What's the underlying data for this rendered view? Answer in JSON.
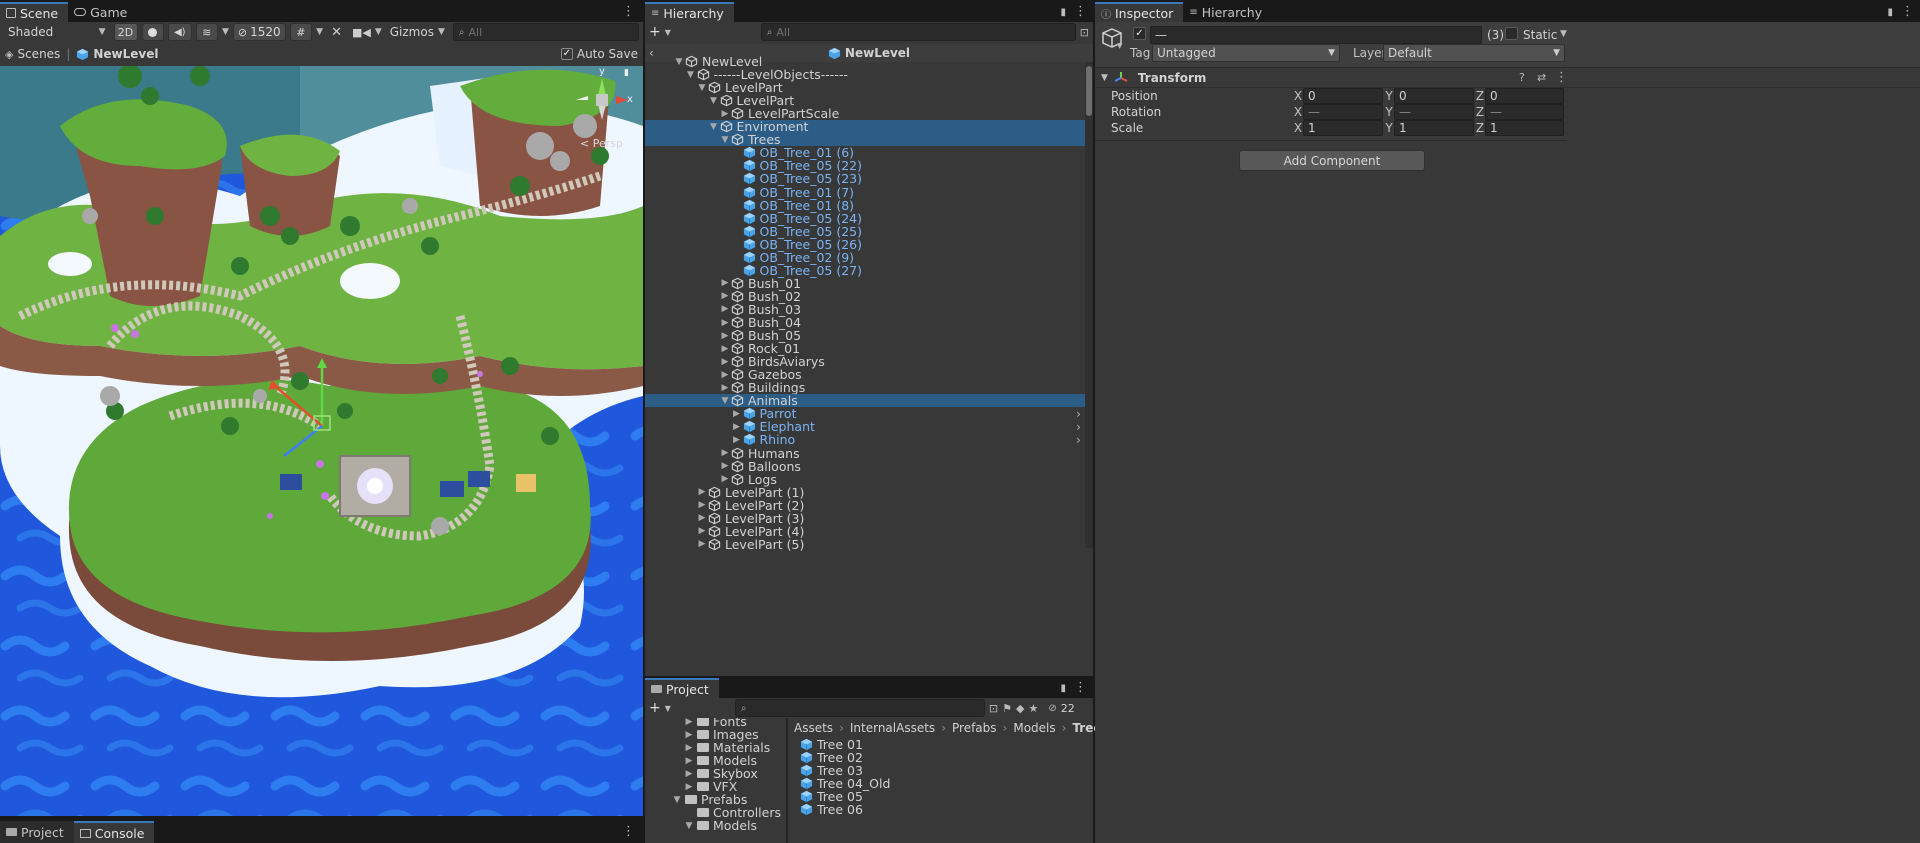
{
  "scene_panel": {
    "tab_scene": "Scene",
    "tab_game": "Game",
    "shading_mode": "Shaded",
    "toggle_2d": "2D",
    "hidden_count": "1520",
    "gizmos": "Gizmos",
    "search_placeholder": "All",
    "breadcrumb_scenes": "Scenes",
    "breadcrumb_level": "NewLevel",
    "auto_save": "Auto Save",
    "persp": "< Persp",
    "axis_y": "y",
    "axis_x": "x"
  },
  "hierarchy": {
    "tab": "Hierarchy",
    "search_placeholder": "All",
    "scene_name": "NewLevel",
    "rows": [
      {
        "label": "NewLevel",
        "depth": 0,
        "arrow": "down",
        "type": "object",
        "selected": false
      },
      {
        "label": "------LevelObjects------",
        "depth": 1,
        "arrow": "down",
        "type": "object",
        "selected": false
      },
      {
        "label": "LevelPart",
        "depth": 2,
        "arrow": "down",
        "type": "object",
        "selected": false
      },
      {
        "label": "LevelPart",
        "depth": 3,
        "arrow": "down",
        "type": "object",
        "selected": false
      },
      {
        "label": "LevelPartScale",
        "depth": 4,
        "arrow": "right",
        "type": "object",
        "selected": false
      },
      {
        "label": "Enviroment",
        "depth": 3,
        "arrow": "down",
        "type": "object",
        "selected": true
      },
      {
        "label": "Trees",
        "depth": 4,
        "arrow": "down",
        "type": "object",
        "selected": true
      },
      {
        "label": "OB_Tree_01 (6)",
        "depth": 5,
        "arrow": "none",
        "type": "prefab",
        "selected": false
      },
      {
        "label": "OB_Tree_05 (22)",
        "depth": 5,
        "arrow": "none",
        "type": "prefab",
        "selected": false
      },
      {
        "label": "OB_Tree_05 (23)",
        "depth": 5,
        "arrow": "none",
        "type": "prefab",
        "selected": false
      },
      {
        "label": "OB_Tree_01 (7)",
        "depth": 5,
        "arrow": "none",
        "type": "prefab",
        "selected": false
      },
      {
        "label": "OB_Tree_01 (8)",
        "depth": 5,
        "arrow": "none",
        "type": "prefab",
        "selected": false
      },
      {
        "label": "OB_Tree_05 (24)",
        "depth": 5,
        "arrow": "none",
        "type": "prefab",
        "selected": false
      },
      {
        "label": "OB_Tree_05 (25)",
        "depth": 5,
        "arrow": "none",
        "type": "prefab",
        "selected": false
      },
      {
        "label": "OB_Tree_05 (26)",
        "depth": 5,
        "arrow": "none",
        "type": "prefab",
        "selected": false
      },
      {
        "label": "OB_Tree_02 (9)",
        "depth": 5,
        "arrow": "none",
        "type": "prefab",
        "selected": false
      },
      {
        "label": "OB_Tree_05 (27)",
        "depth": 5,
        "arrow": "none",
        "type": "prefab",
        "selected": false
      },
      {
        "label": "Bush_01",
        "depth": 4,
        "arrow": "right",
        "type": "object",
        "selected": false
      },
      {
        "label": "Bush_02",
        "depth": 4,
        "arrow": "right",
        "type": "object",
        "selected": false
      },
      {
        "label": "Bush_03",
        "depth": 4,
        "arrow": "right",
        "type": "object",
        "selected": false
      },
      {
        "label": "Bush_04",
        "depth": 4,
        "arrow": "right",
        "type": "object",
        "selected": false
      },
      {
        "label": "Bush_05",
        "depth": 4,
        "arrow": "right",
        "type": "object",
        "selected": false
      },
      {
        "label": "Rock_01",
        "depth": 4,
        "arrow": "right",
        "type": "object",
        "selected": false
      },
      {
        "label": "BirdsAviarys",
        "depth": 4,
        "arrow": "right",
        "type": "object",
        "selected": false
      },
      {
        "label": "Gazebos",
        "depth": 4,
        "arrow": "right",
        "type": "object",
        "selected": false
      },
      {
        "label": "Buildings",
        "depth": 4,
        "arrow": "right",
        "type": "object",
        "selected": false
      },
      {
        "label": "Animals",
        "depth": 4,
        "arrow": "down",
        "type": "object",
        "selected": true
      },
      {
        "label": "Parrot",
        "depth": 5,
        "arrow": "right",
        "type": "prefab",
        "selected": false
      },
      {
        "label": "Elephant",
        "depth": 5,
        "arrow": "right",
        "type": "prefab",
        "selected": false
      },
      {
        "label": "Rhino",
        "depth": 5,
        "arrow": "right",
        "type": "prefab",
        "selected": false
      },
      {
        "label": "Humans",
        "depth": 4,
        "arrow": "right",
        "type": "object",
        "selected": false
      },
      {
        "label": "Balloons",
        "depth": 4,
        "arrow": "right",
        "type": "object",
        "selected": false
      },
      {
        "label": "Logs",
        "depth": 4,
        "arrow": "right",
        "type": "object",
        "selected": false
      },
      {
        "label": "LevelPart (1)",
        "depth": 2,
        "arrow": "right",
        "type": "object",
        "selected": false
      },
      {
        "label": "LevelPart (2)",
        "depth": 2,
        "arrow": "right",
        "type": "object",
        "selected": false
      },
      {
        "label": "LevelPart (3)",
        "depth": 2,
        "arrow": "right",
        "type": "object",
        "selected": false
      },
      {
        "label": "LevelPart (4)",
        "depth": 2,
        "arrow": "right",
        "type": "object",
        "selected": false
      },
      {
        "label": "LevelPart (5)",
        "depth": 2,
        "arrow": "right",
        "type": "object",
        "selected": false
      }
    ]
  },
  "project": {
    "tab": "Project",
    "hidden_count": "22",
    "folders": [
      {
        "label": "Fonts",
        "depth": 1,
        "arrow": "right"
      },
      {
        "label": "Images",
        "depth": 1,
        "arrow": "right"
      },
      {
        "label": "Materials",
        "depth": 1,
        "arrow": "right"
      },
      {
        "label": "Models",
        "depth": 1,
        "arrow": "right"
      },
      {
        "label": "Skybox",
        "depth": 1,
        "arrow": "right"
      },
      {
        "label": "VFX",
        "depth": 1,
        "arrow": "right"
      },
      {
        "label": "Prefabs",
        "depth": 0,
        "arrow": "down"
      },
      {
        "label": "Controllers",
        "depth": 1,
        "arrow": "none"
      },
      {
        "label": "Models",
        "depth": 1,
        "arrow": "down"
      }
    ],
    "breadcrumb": [
      "Assets",
      "InternalAssets",
      "Prefabs",
      "Models",
      "Trees"
    ],
    "assets": [
      "Tree 01",
      "Tree 02",
      "Tree 03",
      "Tree 04_Old",
      "Tree 05",
      "Tree 06"
    ]
  },
  "inspector": {
    "tab_inspector": "Inspector",
    "tab_hierarchy": "Hierarchy",
    "name_value": "—",
    "count": "(3)",
    "static": "Static",
    "tag_label": "Tag",
    "tag_value": "Untagged",
    "layer_label": "Layer",
    "layer_value": "Default",
    "component_title": "Transform",
    "position_label": "Position",
    "rotation_label": "Rotation",
    "scale_label": "Scale",
    "axis_x": "X",
    "axis_y": "Y",
    "axis_z": "Z",
    "position": [
      "0",
      "0",
      "0"
    ],
    "rotation": [
      "—",
      "—",
      "—"
    ],
    "scale": [
      "1",
      "1",
      "1"
    ],
    "add_component": "Add Component"
  },
  "bottom_left": {
    "tab_project": "Project",
    "tab_console": "Console"
  },
  "colors": {
    "selection": "#2c5d87",
    "prefab_text": "#7ab4f5",
    "panel": "#383838",
    "ocean": "#1e56d8"
  }
}
